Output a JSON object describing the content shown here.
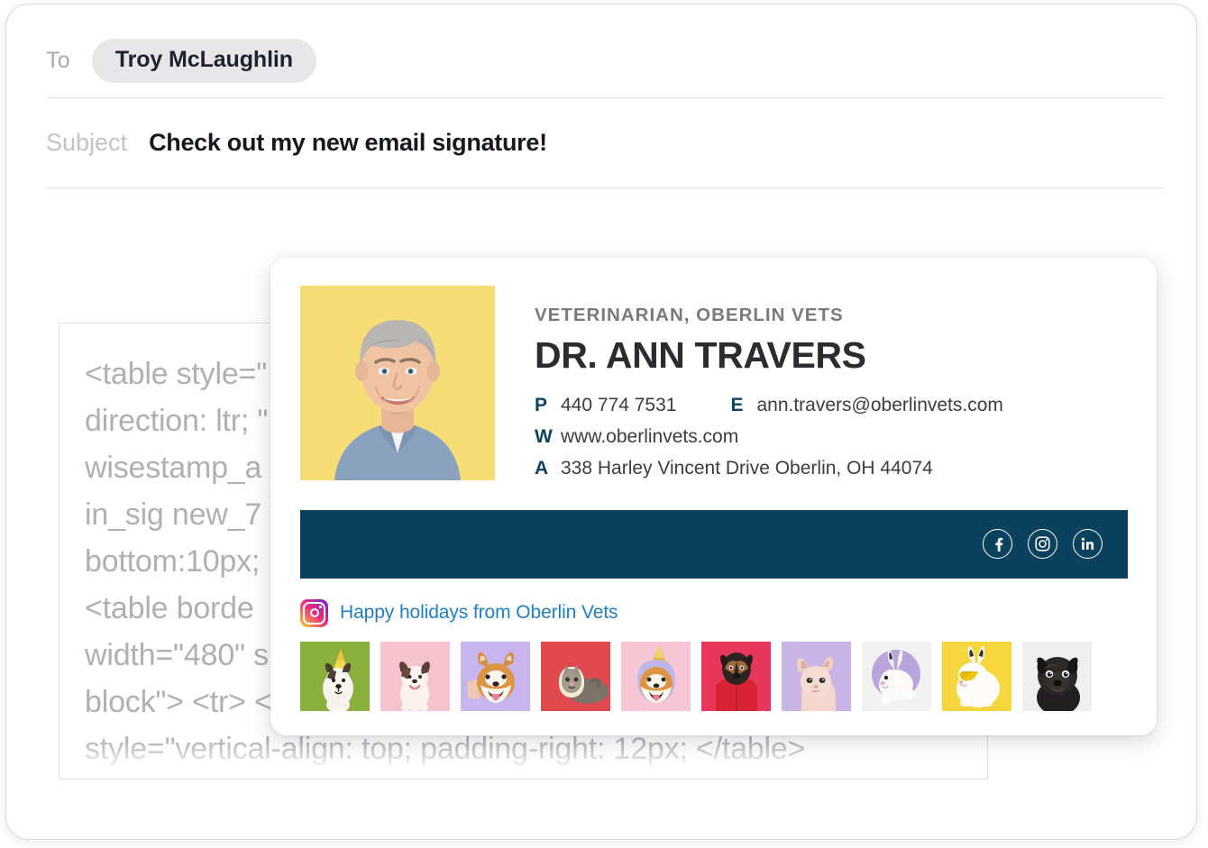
{
  "compose": {
    "to_label": "To",
    "recipient": "Troy McLaughlin",
    "subject_label": "Subject",
    "subject_value": "Check out my new email signature!"
  },
  "code_editor": {
    "lines": [
      "<table style=\"",
      "direction: ltr; \"",
      "wisestamp_a",
      "in_sig new_7",
      "bottom:10px;",
      "<table borde",
      "width=\"480\" s",
      "block\"> <tr> <",
      "style=\"vertical-align: top; padding-right: 12px; </table>"
    ]
  },
  "signature": {
    "role": "VETERINARIAN, OBERLIN VETS",
    "name": "DR. ANN TRAVERS",
    "contacts": {
      "phone_key": "P",
      "phone_value": "440 774 7531",
      "email_key": "E",
      "email_value": "ann.travers@oberlinvets.com",
      "web_key": "W",
      "web_value": "www.oberlinvets.com",
      "address_key": "A",
      "address_value": "338 Harley Vincent Drive Oberlin, OH 44074"
    },
    "social": [
      {
        "name": "facebook-icon"
      },
      {
        "name": "instagram-icon"
      },
      {
        "name": "linkedin-icon"
      }
    ],
    "instagram_feed": {
      "icon": "instagram-icon",
      "caption": "Happy holidays from Oberlin Vets",
      "thumbnails": [
        {
          "alt": "dog with party hat",
          "bg": "#8aaf3c"
        },
        {
          "alt": "french bulldog puppy",
          "bg": "#f7c3ce"
        },
        {
          "alt": "shiba inu smiling",
          "bg": "#c7b6ee"
        },
        {
          "alt": "cat in bread slice",
          "bg": "#e04a4f"
        },
        {
          "alt": "shiba inu in hood",
          "bg": "#f6c6d4"
        },
        {
          "alt": "dachshund in red coat",
          "bg": "#e8365c"
        },
        {
          "alt": "sphynx cat",
          "bg": "#c9b4e6"
        },
        {
          "alt": "white rabbit",
          "bg": "#f2f2f2"
        },
        {
          "alt": "rabbit with sunglasses",
          "bg": "#f5d73d"
        },
        {
          "alt": "black pug",
          "bg": "#efefef"
        }
      ]
    },
    "colors": {
      "navy": "#0b415f",
      "portrait_bg": "#f7dd76",
      "link_blue": "#1f7fc4"
    }
  }
}
